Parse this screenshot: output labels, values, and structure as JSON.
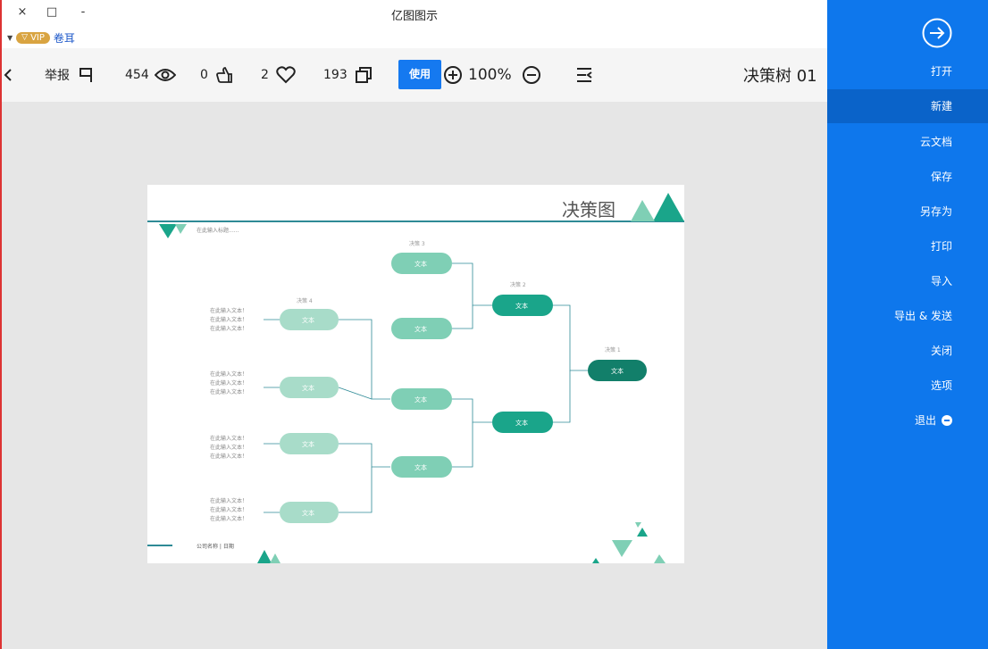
{
  "window": {
    "title": "亿图图示",
    "close": "×",
    "maximize": "□",
    "minimize": "-"
  },
  "account": {
    "badge": "VIP",
    "name": "卷耳"
  },
  "toolbar": {
    "report_label": "举报",
    "views": "454",
    "likes": "0",
    "favorites": "2",
    "copies": "193",
    "use_label": "使用",
    "zoom": "100%",
    "doc_title": "决策树 01"
  },
  "sidebar": {
    "items": [
      {
        "label": "打开"
      },
      {
        "label": "新建"
      },
      {
        "label": "云文档"
      },
      {
        "label": "保存"
      },
      {
        "label": "另存为"
      },
      {
        "label": "打印"
      },
      {
        "label": "导入"
      },
      {
        "label": "导出 & 发送"
      },
      {
        "label": "关闭"
      },
      {
        "label": "选项"
      },
      {
        "label": "退出"
      }
    ]
  },
  "diagram": {
    "title": "决策图",
    "subtitle": "在此输入标题......",
    "footer": "公司名称 | 日期",
    "node_text": "文本",
    "label_1": "决策 1",
    "label_2": "决策 2",
    "label_3": "决策 3",
    "label_4": "决策 4",
    "leaf_text": "在此输入文本！",
    "colors": {
      "dark": "#127f6a",
      "mid": "#1aa58a",
      "light": "#7fcfb5",
      "pale": "#a8dcc9",
      "line": "#2e8a96"
    }
  }
}
